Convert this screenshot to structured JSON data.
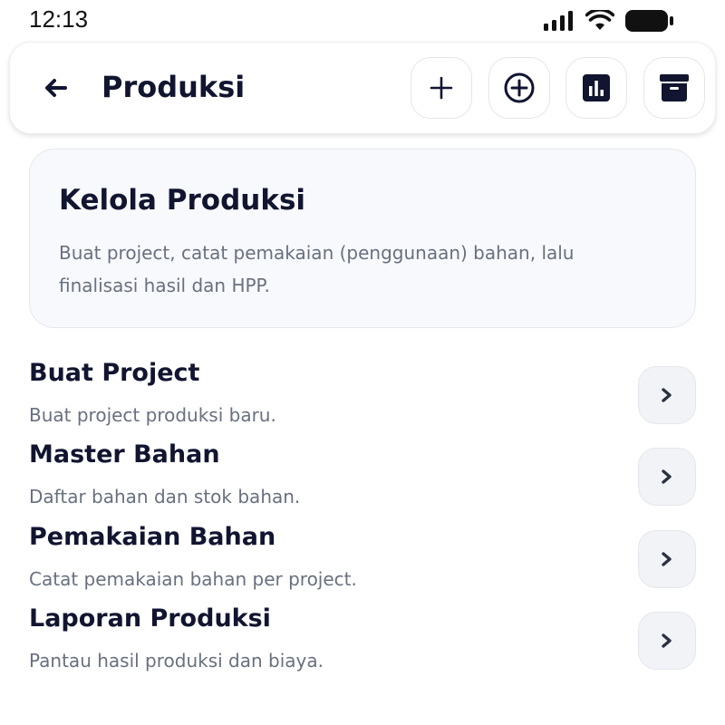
{
  "status_bar": {
    "time": "12:13"
  },
  "app_bar": {
    "title": "Produksi",
    "actions": [
      {
        "icon": "plus-icon"
      },
      {
        "icon": "circle-plus-icon"
      },
      {
        "icon": "bar-chart-icon"
      },
      {
        "icon": "archive-icon"
      }
    ]
  },
  "intro": {
    "title": "Kelola Produksi",
    "description": "Buat project, catat pemakaian (penggunaan) bahan, lalu finalisasi hasil dan HPP."
  },
  "menu": [
    {
      "title": "Buat Project",
      "subtitle": "Buat project produksi baru."
    },
    {
      "title": "Master Bahan",
      "subtitle": "Daftar bahan dan stok bahan."
    },
    {
      "title": "Pemakaian Bahan",
      "subtitle": "Catat pemakaian bahan per project."
    },
    {
      "title": "Laporan Produksi",
      "subtitle": "Pantau hasil produksi dan biaya."
    }
  ],
  "colors": {
    "text_primary": "#111530",
    "text_secondary": "#68707f",
    "card_bg": "#f8f9fc",
    "chevron_bg": "#f1f3f7"
  }
}
